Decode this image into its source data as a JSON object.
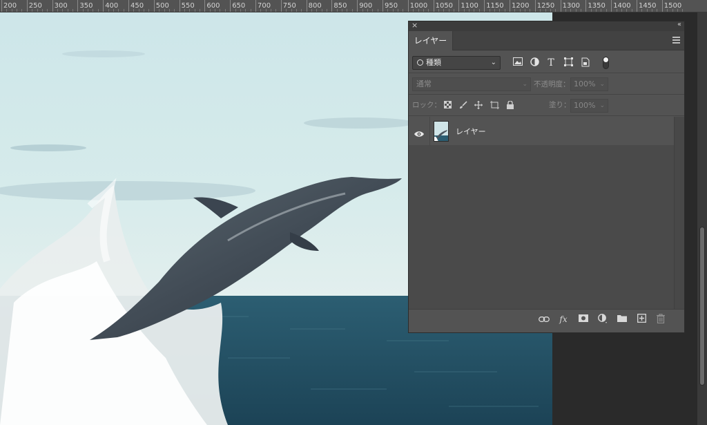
{
  "ruler": {
    "labels": [
      "200",
      "250",
      "300",
      "350",
      "400",
      "450",
      "500",
      "550",
      "600",
      "650",
      "700",
      "750",
      "800",
      "850",
      "900",
      "950",
      "1000",
      "1050",
      "1100",
      "1150",
      "1200",
      "1250",
      "1300",
      "1350",
      "1400",
      "1450",
      "1500"
    ]
  },
  "panel": {
    "tab_label": "レイヤー",
    "close_glyph": "×",
    "collapse_glyph": "‹‹",
    "filter": {
      "value": "種類",
      "chevron": "⌄"
    },
    "filter_icons": [
      "image-filter-icon",
      "adjustment-filter-icon",
      "type-filter-icon",
      "shape-filter-icon",
      "smart-object-filter-icon"
    ],
    "blend_mode": "通常",
    "opacity_label": "不透明度：",
    "opacity_value": "100%",
    "lock_label": "ロック：",
    "fill_label": "塗り：",
    "fill_value": "100%",
    "layers": [
      {
        "name": "レイヤー",
        "visible": true
      }
    ],
    "bottom_icons": [
      "link-layers-icon",
      "fx-icon",
      "add-mask-icon",
      "adjustment-layer-icon",
      "new-group-icon",
      "new-layer-icon",
      "trash-icon"
    ]
  }
}
